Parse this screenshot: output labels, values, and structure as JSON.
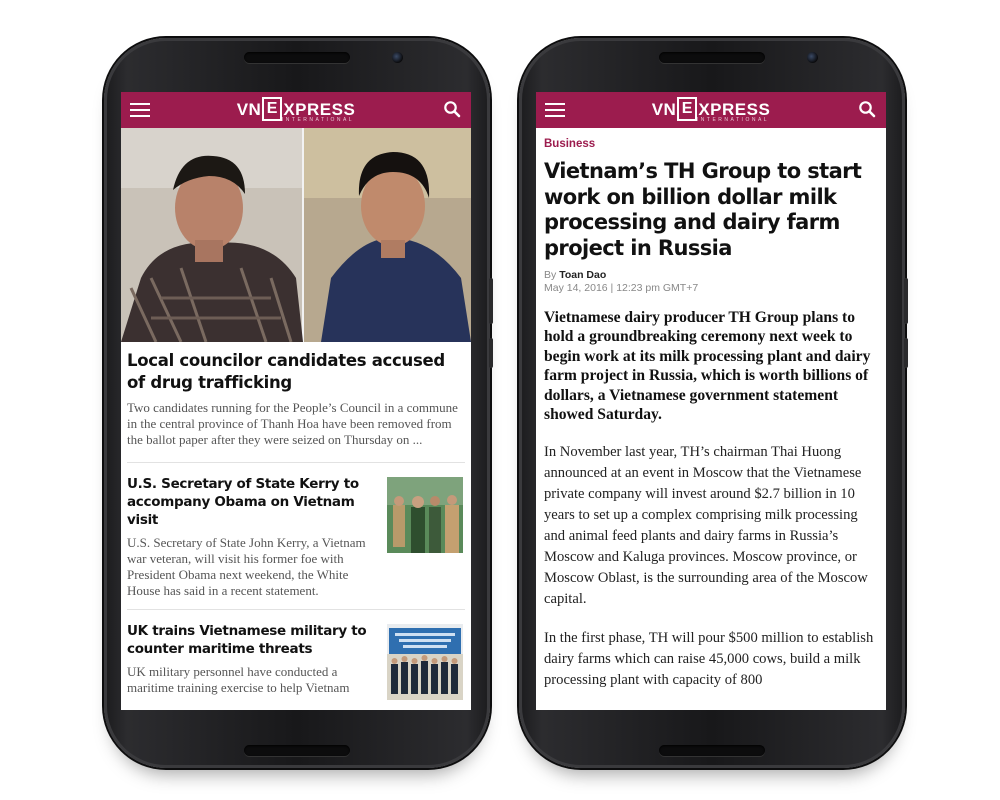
{
  "brand": {
    "logo_left": "VN",
    "logo_box": "E",
    "logo_right": "XPRESS",
    "logo_sub": "INTERNATIONAL",
    "bar_color": "#9c1c4e"
  },
  "left_screen": {
    "featured": {
      "title": "Local councilor candidates accused of drug trafficking",
      "description": "Two candidates running for the People’s Council in a commune in the central province of Thanh Hoa have been removed from the ballot paper after they were seized on Thursday on ..."
    },
    "stories": [
      {
        "title": "U.S. Secretary of State Kerry to accompany Obama on Vietnam visit",
        "description": "U.S. Secretary of State John Kerry, a Vietnam war veteran, will visit his former foe with President Obama next weekend, the White House has said in a recent statement."
      },
      {
        "title": "UK trains Vietnamese military to counter maritime threats",
        "description": "UK military personnel have conducted a maritime training exercise to help Vietnam"
      }
    ]
  },
  "right_screen": {
    "category": "Business",
    "headline": "Vietnam’s TH Group to start work on billion dollar milk processing and dairy farm project in Russia",
    "by_label": "By",
    "author": "Toan Dao",
    "dateline": "May 14, 2016 | 12:23 pm GMT+7",
    "lede": "Vietnamese dairy producer TH Group plans to hold a groundbreaking ceremony next week to begin work at its milk processing plant and dairy farm project in Russia, which is worth billions of dollars, a Vietnamese government statement showed Saturday.",
    "paragraphs": [
      "In November last year, TH’s chairman Thai Huong announced at an event in Moscow that the Vietnamese private company will invest around $2.7 billion in 10 years to set up a complex comprising milk processing and animal feed plants and dairy farms in Russia’s Moscow and Kaluga provinces. Moscow province, or Moscow Oblast, is the surrounding area of the Moscow capital.",
      "In the first phase, TH will pour $500 million to establish dairy farms which can raise 45,000 cows, build a milk processing plant with capacity of 800"
    ]
  },
  "icons": {
    "menu": "hamburger-menu-icon",
    "search": "search-icon"
  }
}
